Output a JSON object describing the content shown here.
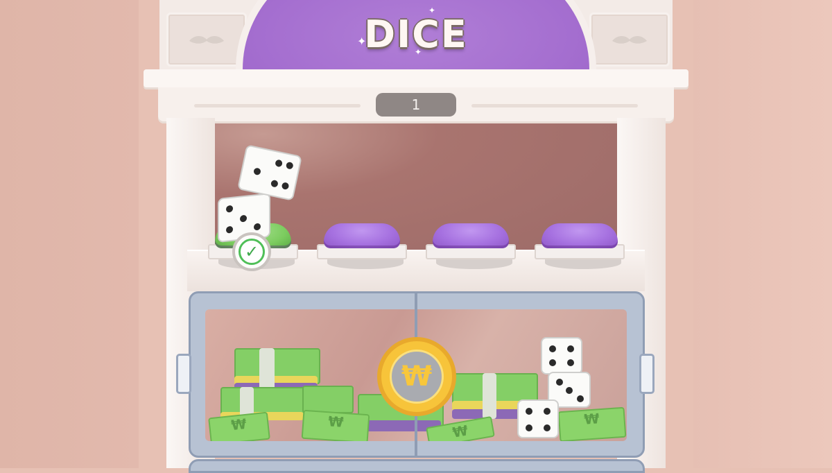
{
  "game": {
    "title": "DICE",
    "counter": "1",
    "prize_buttons": [
      {
        "state": "claimed",
        "color": "#7ccc5f"
      },
      {
        "state": "locked",
        "color": "#a671e0"
      },
      {
        "state": "locked",
        "color": "#a671e0"
      },
      {
        "state": "locked",
        "color": "#a671e0"
      }
    ],
    "claimed_icon": "check-icon",
    "coin_symbol": "₩",
    "bill_symbol": "₩"
  }
}
